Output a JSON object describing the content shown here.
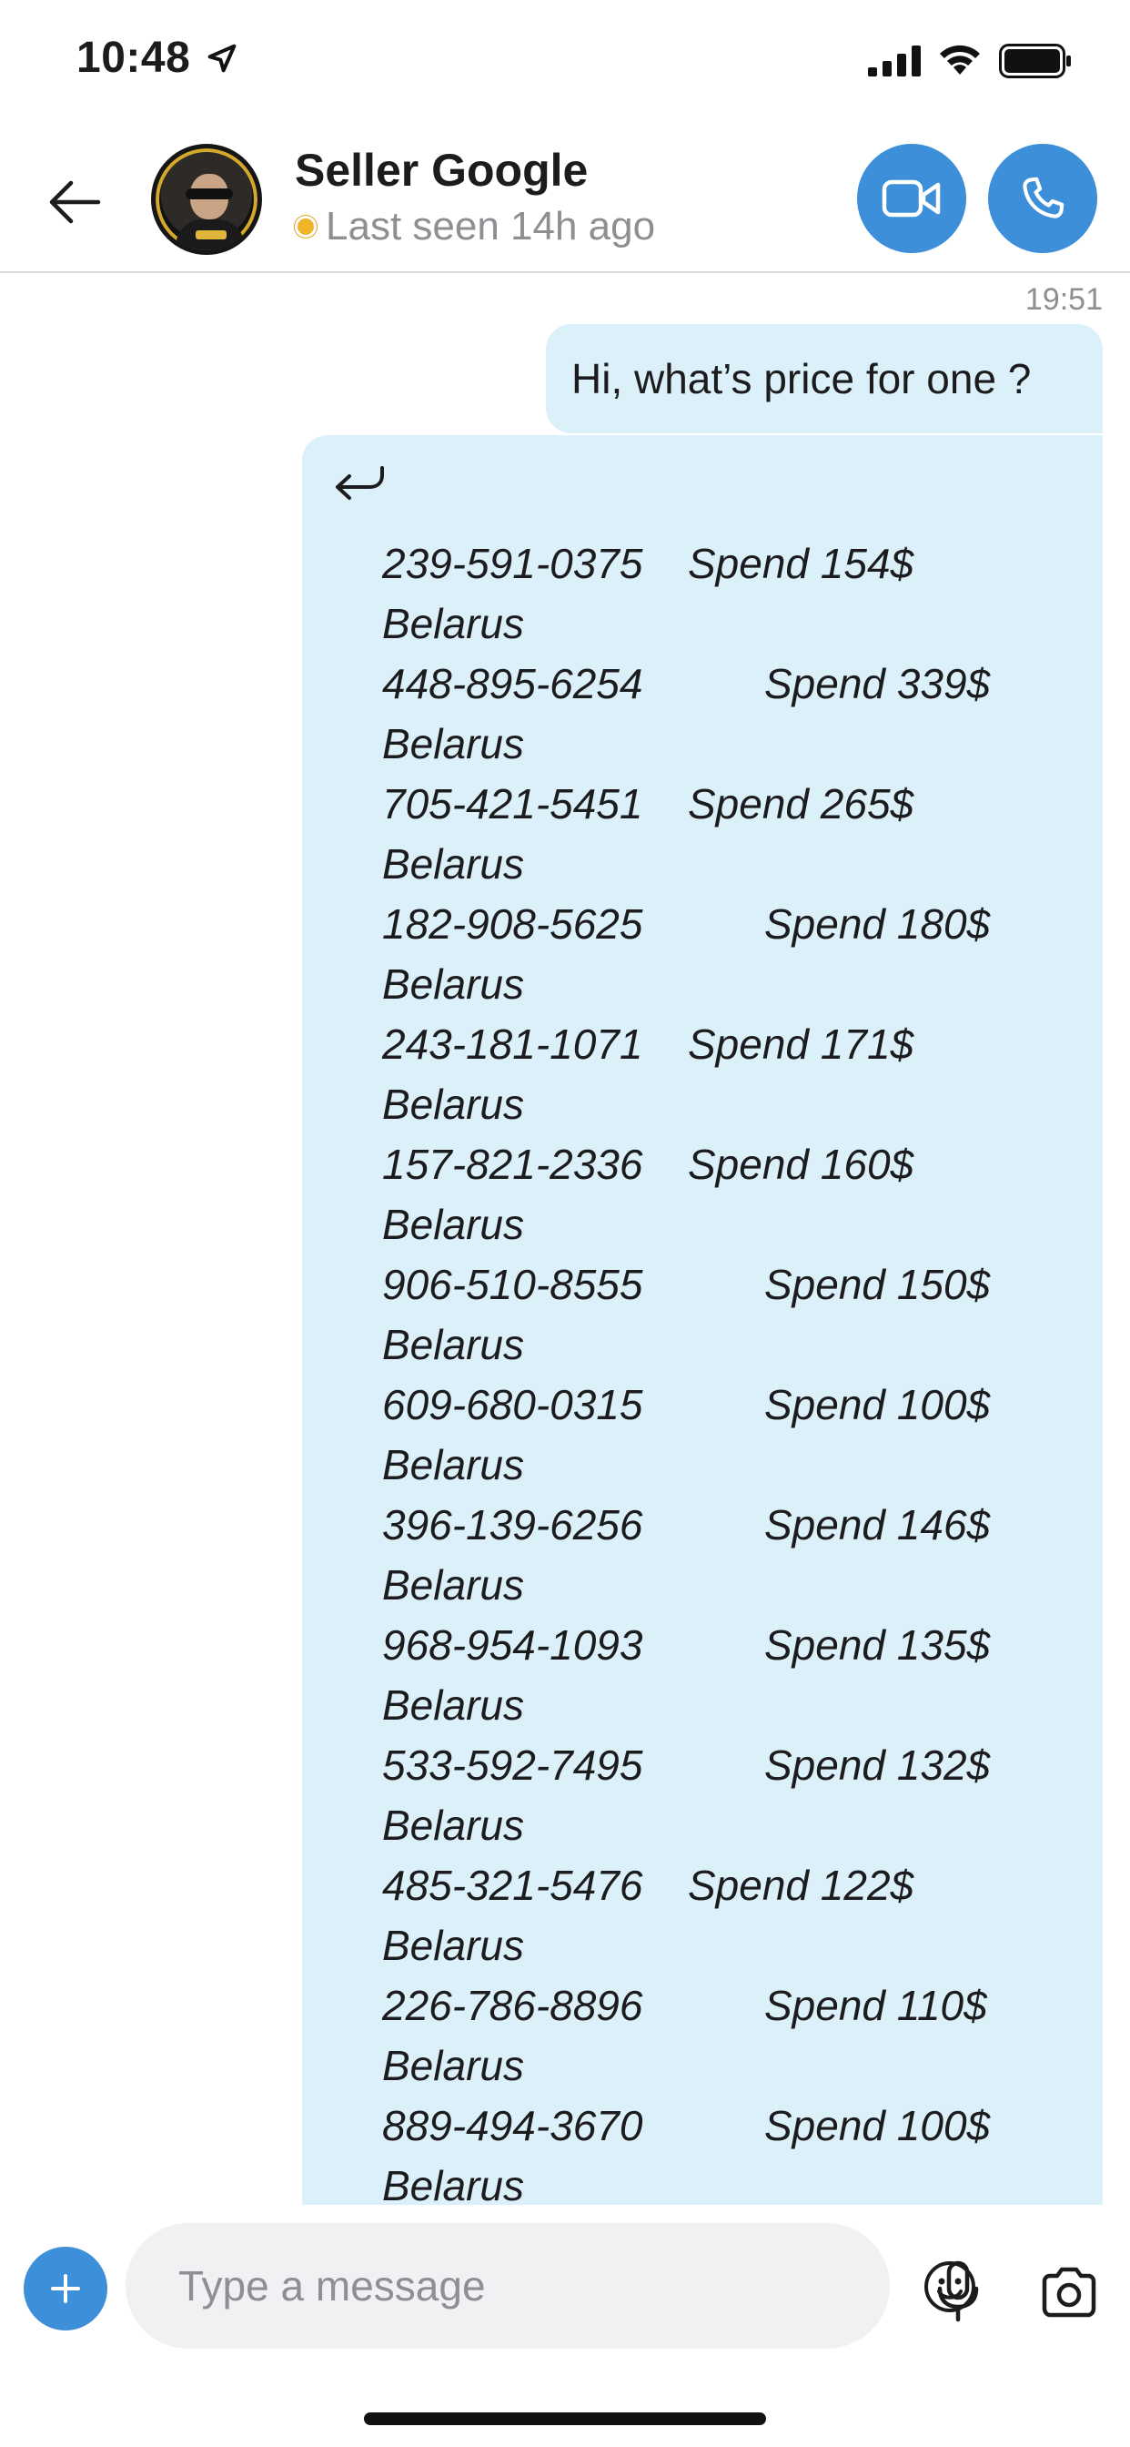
{
  "status_bar": {
    "time": "10:48",
    "icons": [
      "location-arrow-icon",
      "cellular-signal-icon",
      "wifi-icon",
      "battery-icon"
    ]
  },
  "header": {
    "back_icon": "back-arrow-icon",
    "contact_name": "Seller Google",
    "presence": "Last seen 14h ago",
    "presence_color": "#f0b429",
    "accent": "#3d8fd9",
    "video_icon": "video-camera-icon",
    "call_icon": "phone-icon"
  },
  "messages": {
    "timestamp": "19:51",
    "first": "Hi, what’s price for one ?",
    "bubble_color": "#dcf0f9",
    "forwarded_icon": "reply-arrow-icon",
    "rows": [
      {
        "phone": "239-591-0375",
        "spend": "Spend 154$",
        "country": "Belarus"
      },
      {
        "phone": "448-895-6254",
        "spend": "Spend 339$",
        "country": "Belarus"
      },
      {
        "phone": "705-421-5451",
        "spend": "Spend 265$",
        "country": "Belarus"
      },
      {
        "phone": "182-908-5625",
        "spend": "Spend 180$",
        "country": "Belarus"
      },
      {
        "phone": "243-181-1071",
        "spend": "Spend 171$",
        "country": "Belarus"
      },
      {
        "phone": "157-821-2336",
        "spend": "Spend 160$",
        "country": "Belarus"
      },
      {
        "phone": "906-510-8555",
        "spend": "Spend 150$",
        "country": "Belarus"
      },
      {
        "phone": "609-680-0315",
        "spend": "Spend 100$",
        "country": "Belarus"
      },
      {
        "phone": "396-139-6256",
        "spend": "Spend 146$",
        "country": "Belarus"
      },
      {
        "phone": "968-954-1093",
        "spend": "Spend 135$",
        "country": "Belarus"
      },
      {
        "phone": "533-592-7495",
        "spend": "Spend 132$",
        "country": "Belarus"
      },
      {
        "phone": "485-321-5476",
        "spend": "Spend 122$",
        "country": "Belarus"
      },
      {
        "phone": "226-786-8896",
        "spend": "Spend 110$",
        "country": "Belarus"
      },
      {
        "phone": "889-494-3670",
        "spend": "Spend 100$",
        "country": "Belarus"
      }
    ]
  },
  "scroll_down_icon": "chevron-down-icon",
  "composer": {
    "placeholder": "Type a message",
    "plus_icon": "plus-icon",
    "emoji_icon": "emoji-icon",
    "mic_icon": "microphone-icon",
    "camera_icon": "camera-icon"
  }
}
